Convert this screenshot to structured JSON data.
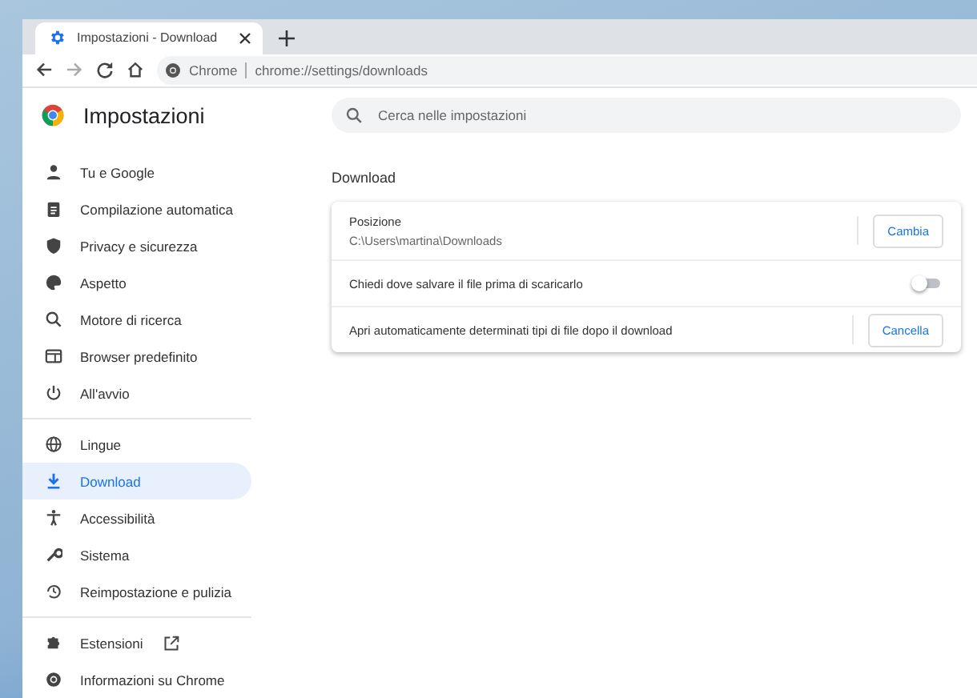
{
  "tab": {
    "title": "Impostazioni - Download"
  },
  "address_bar": {
    "site": "Chrome",
    "url": "chrome://settings/downloads"
  },
  "header": {
    "title": "Impostazioni"
  },
  "search": {
    "placeholder": "Cerca nelle impostazioni"
  },
  "sidebar": {
    "groups": [
      {
        "items": [
          {
            "label": "Tu e Google",
            "selected": false
          },
          {
            "label": "Compilazione automatica",
            "selected": false
          },
          {
            "label": "Privacy e sicurezza",
            "selected": false
          },
          {
            "label": "Aspetto",
            "selected": false
          },
          {
            "label": "Motore di ricerca",
            "selected": false
          },
          {
            "label": "Browser predefinito",
            "selected": false
          },
          {
            "label": "All'avvio",
            "selected": false
          }
        ]
      },
      {
        "items": [
          {
            "label": "Lingue",
            "selected": false
          },
          {
            "label": "Download",
            "selected": true
          },
          {
            "label": "Accessibilità",
            "selected": false
          },
          {
            "label": "Sistema",
            "selected": false
          },
          {
            "label": "Reimpostazione e pulizia",
            "selected": false
          }
        ]
      },
      {
        "items": [
          {
            "label": "Estensioni",
            "selected": false,
            "external": true
          },
          {
            "label": "Informazioni su Chrome",
            "selected": false
          }
        ]
      }
    ]
  },
  "section": {
    "title": "Download",
    "rows": [
      {
        "kind": "button",
        "label": "Posizione",
        "sublabel": "C:\\Users\\martina\\Downloads",
        "button": "Cambia"
      },
      {
        "kind": "toggle",
        "label": "Chiedi dove salvare il file prima di scaricarlo",
        "on": false
      },
      {
        "kind": "button",
        "label": "Apri automaticamente determinati tipi di file dopo il download",
        "button": "Cancella"
      }
    ]
  }
}
